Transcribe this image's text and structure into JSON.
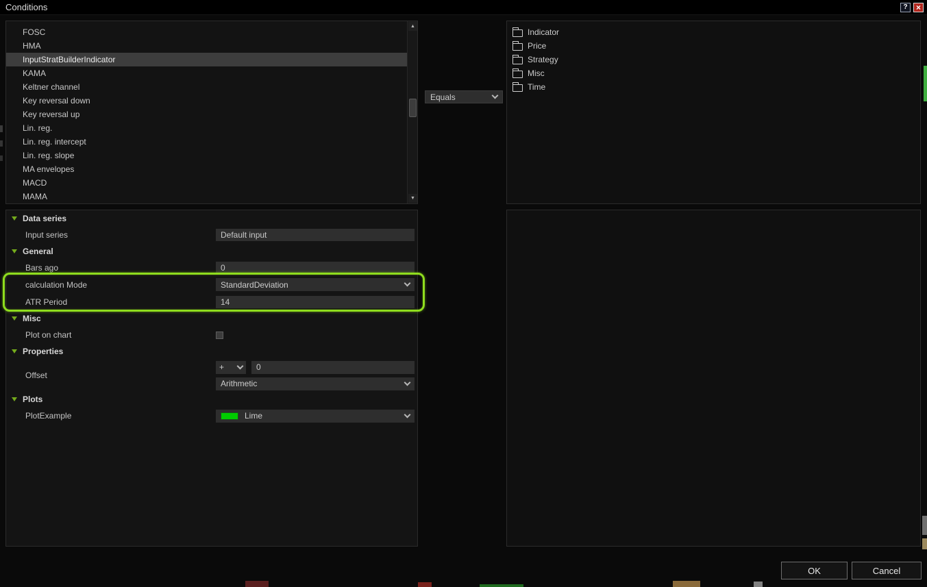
{
  "window": {
    "title": "Conditions",
    "help_button": "?",
    "close_button": "×"
  },
  "indicator_list": {
    "items": [
      "FOSC",
      "HMA",
      "InputStratBuilderIndicator",
      "KAMA",
      "Keltner channel",
      "Key reversal down",
      "Key reversal up",
      "Lin. reg.",
      "Lin. reg. intercept",
      "Lin. reg. slope",
      "MA envelopes",
      "MACD",
      "MAMA"
    ],
    "selected_item": "InputStratBuilderIndicator"
  },
  "operator": {
    "value": "Equals"
  },
  "category_tree": {
    "items": [
      {
        "label": "Indicator",
        "icon": "folder-icon"
      },
      {
        "label": "Price",
        "icon": "folder-icon"
      },
      {
        "label": "Strategy",
        "icon": "folder-icon"
      },
      {
        "label": "Misc",
        "icon": "folder-icon"
      },
      {
        "label": "Time",
        "icon": "folder-icon"
      }
    ]
  },
  "property_grid": {
    "data_series": {
      "header": "Data series",
      "input_series": {
        "label": "Input series",
        "value": "Default input"
      }
    },
    "general": {
      "header": "General",
      "bars_ago": {
        "label": "Bars ago",
        "value": "0"
      },
      "calculation_mode": {
        "label": "calculation Mode",
        "value": "StandardDeviation"
      },
      "atr_period": {
        "label": "ATR Period",
        "value": "14"
      }
    },
    "misc": {
      "header": "Misc",
      "plot_on_chart": {
        "label": "Plot on chart",
        "checked": false
      }
    },
    "properties": {
      "header": "Properties",
      "offset": {
        "label": "Offset",
        "sign": "+",
        "value": "0",
        "mode": "Arithmetic"
      }
    },
    "plots": {
      "header": "Plots",
      "plot_example": {
        "label": "PlotExample",
        "value": "Lime",
        "swatch_color": "#00cc00"
      }
    }
  },
  "annotation": {
    "highlight_color": "#8fdd1e"
  },
  "footer": {
    "ok": "OK",
    "cancel": "Cancel"
  }
}
